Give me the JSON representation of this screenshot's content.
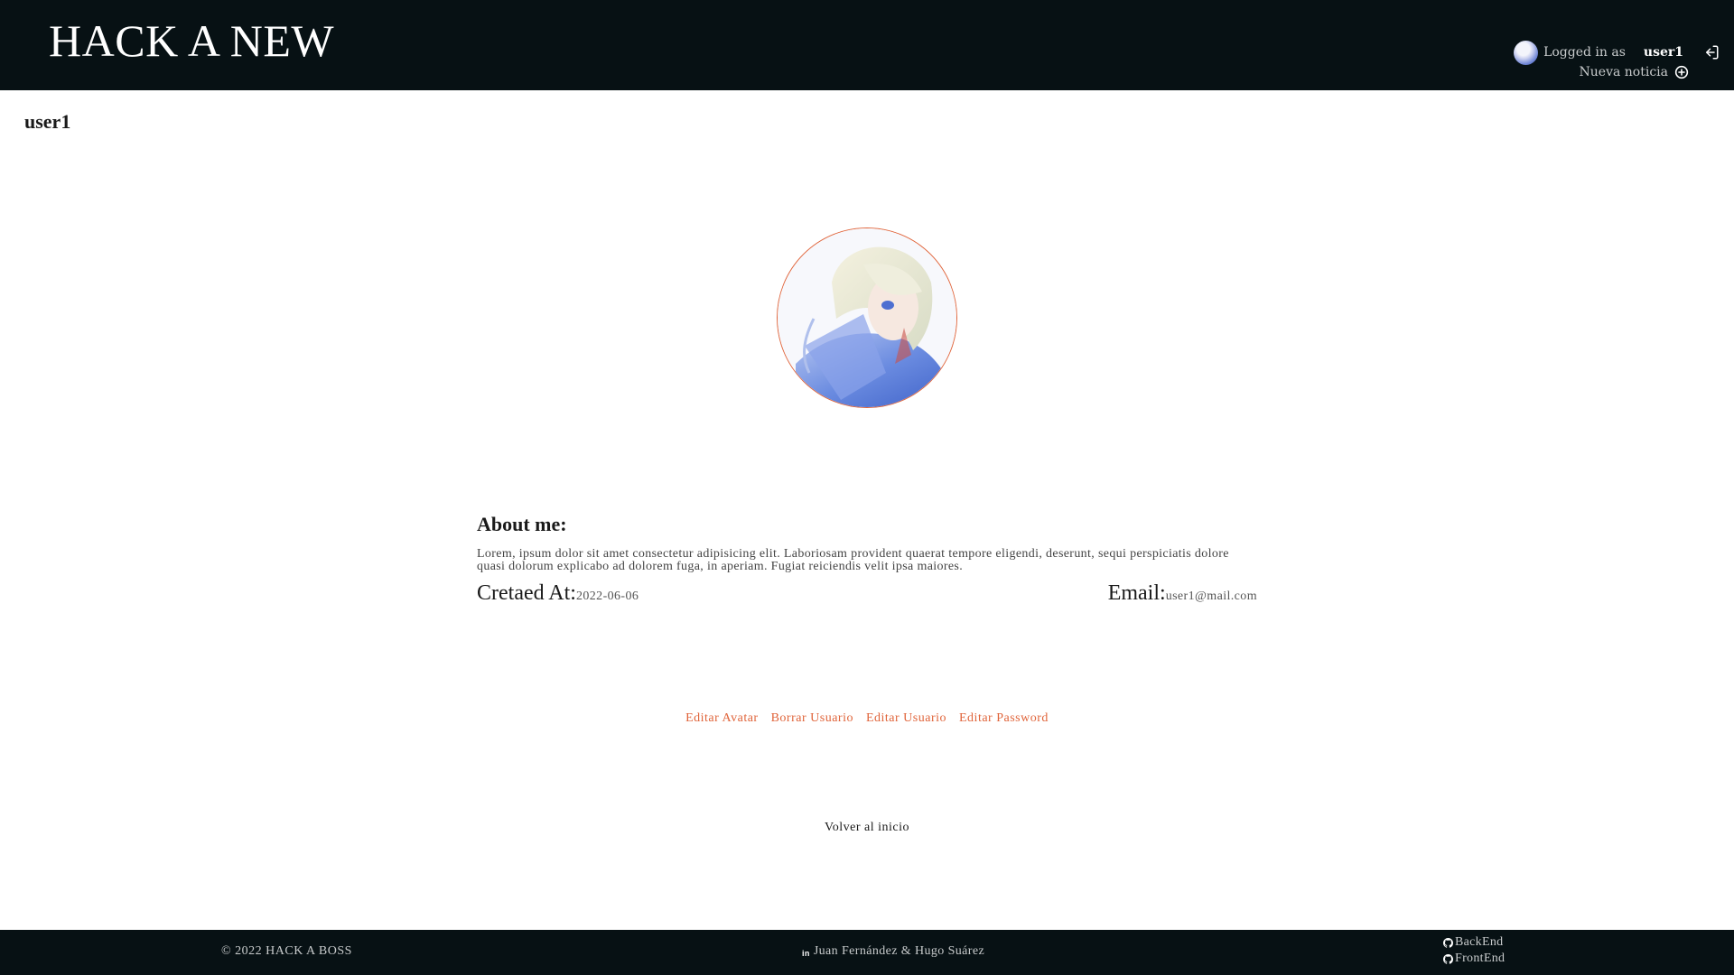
{
  "header": {
    "brand": "HACK A NEW",
    "logged_in_label": "Logged in as",
    "username": "user1",
    "new_news_label": "Nueva noticia",
    "icons": {
      "logout": "logout-icon",
      "add": "plus-circle-icon",
      "avatar": "avatar"
    }
  },
  "profile": {
    "username": "user1",
    "about_title": "About me:",
    "about_text": "Lorem, ipsum dolor sit amet consectetur adipisicing elit. Laboriosam provident quaerat tempore eligendi, deserunt, sequi perspiciatis dolore quasi dolorum explicabo ad dolorem fuga, in aperiam. Fugiat reiciendis velit ipsa maiores.",
    "created_label": "Cretaed At:",
    "created_value": "2022-06-06",
    "email_label": "Email:",
    "email_value": "user1@mail.com"
  },
  "actions": [
    {
      "label": "Editar Avatar"
    },
    {
      "label": "Borrar Usuario"
    },
    {
      "label": "Editar Usuario"
    },
    {
      "label": "Editar Password"
    }
  ],
  "back_home": "Volver al inicio",
  "footer": {
    "copyright": "© 2022 HACK A BOSS",
    "linkedin_icon_text": "in",
    "authors": "Juan Fernández & Hugo Suárez",
    "repos": [
      {
        "label": "BackEnd",
        "icon": "github-icon"
      },
      {
        "label": "FrontEnd",
        "icon": "github-icon"
      }
    ]
  },
  "colors": {
    "header_bg": "#071114",
    "accent": "#e0643a",
    "text": "#1a1a1a"
  }
}
